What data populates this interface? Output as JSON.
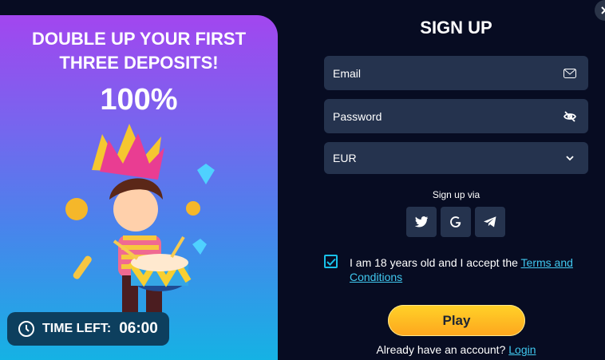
{
  "promo": {
    "headline": "DOUBLE UP YOUR FIRST THREE DEPOSITS!",
    "percent": "100%",
    "timer": {
      "label": "TIME LEFT:",
      "value": "06:00"
    }
  },
  "signup": {
    "title": "SIGN UP",
    "email_label": "Email",
    "password_label": "Password",
    "currency_value": "EUR",
    "sign_up_via": "Sign up via",
    "social": [
      "twitter-icon",
      "google-icon",
      "telegram-icon"
    ],
    "terms_text": "I am 18 years old and I accept the ",
    "terms_link": "Terms and Conditions",
    "play_label": "Play",
    "login_prompt": "Already have an account? ",
    "login_link": "Login"
  },
  "colors": {
    "accent": "#40c8ef",
    "button": "#fea61e",
    "background": "#070c22"
  }
}
